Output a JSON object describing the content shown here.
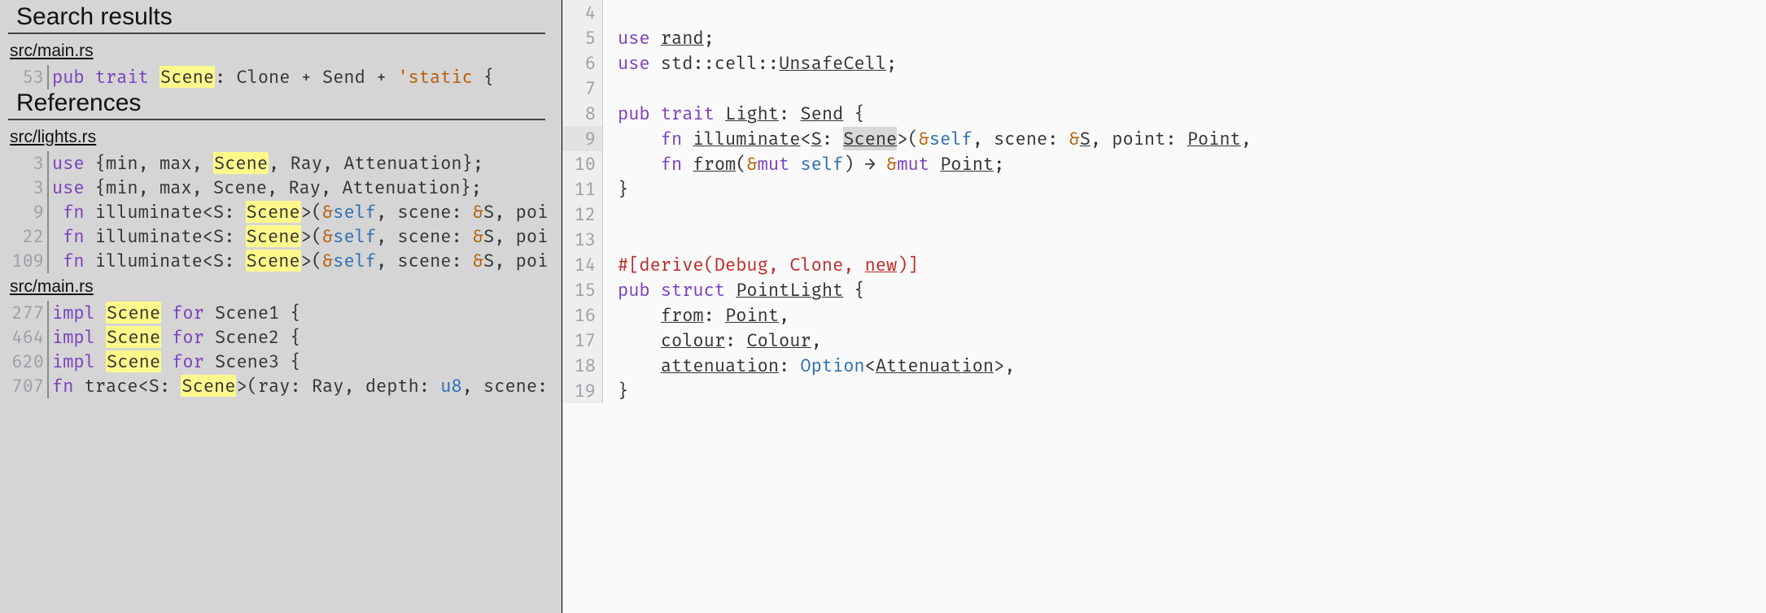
{
  "left": {
    "searchHeader": "Search results",
    "refsHeader": "References",
    "groups": [
      {
        "file": "src/main.rs",
        "results": [
          {
            "line": 53,
            "tokens": [
              [
                "kw",
                "pub"
              ],
              [
                "",
                ""
              ],
              [
                "kw",
                " trait "
              ],
              [
                "hl",
                "Scene"
              ],
              [
                "",
                ""
              ],
              [
                "",
                ": Clone + Send + "
              ],
              [
                "str",
                "'static"
              ],
              [
                "",
                " {"
              ]
            ]
          }
        ]
      }
    ],
    "refGroups": [
      {
        "file": "src/lights.rs",
        "results": [
          {
            "line": 3,
            "tokens": [
              [
                "kw",
                "use"
              ],
              [
                "",
                " {min, max, "
              ],
              [
                "hl",
                "Scene"
              ],
              [
                "",
                ", Ray, Attenuation};"
              ]
            ]
          },
          {
            "line": 3,
            "tokens": [
              [
                "kw",
                "use"
              ],
              [
                "",
                " {min, max, Scene, Ray, Attenuation};"
              ]
            ]
          },
          {
            "line": 9,
            "tokens": [
              [
                "",
                " "
              ],
              [
                "kw",
                "fn"
              ],
              [
                "",
                " illuminate<S: "
              ],
              [
                "hl",
                "Scene"
              ],
              [
                "",
                ">("
              ],
              [
                "amp",
                "&"
              ],
              [
                "self",
                "self"
              ],
              [
                "",
                ", scene: "
              ],
              [
                "amp",
                "&"
              ],
              [
                "",
                "S, poi"
              ]
            ]
          },
          {
            "line": 22,
            "tokens": [
              [
                "",
                " "
              ],
              [
                "kw",
                "fn"
              ],
              [
                "",
                " illuminate<S: "
              ],
              [
                "hl",
                "Scene"
              ],
              [
                "",
                ">("
              ],
              [
                "amp",
                "&"
              ],
              [
                "self",
                "self"
              ],
              [
                "",
                ", scene: "
              ],
              [
                "amp",
                "&"
              ],
              [
                "",
                "S, poi"
              ]
            ]
          },
          {
            "line": 109,
            "tokens": [
              [
                "",
                " "
              ],
              [
                "kw",
                "fn"
              ],
              [
                "",
                " illuminate<S: "
              ],
              [
                "hl",
                "Scene"
              ],
              [
                "",
                ">("
              ],
              [
                "amp",
                "&"
              ],
              [
                "self",
                "self"
              ],
              [
                "",
                ", scene: "
              ],
              [
                "amp",
                "&"
              ],
              [
                "",
                "S, poi"
              ]
            ]
          }
        ]
      },
      {
        "file": "src/main.rs",
        "results": [
          {
            "line": 277,
            "tokens": [
              [
                "kw",
                "impl"
              ],
              [
                "",
                " "
              ],
              [
                "hl",
                "Scene"
              ],
              [
                "",
                " "
              ],
              [
                "kw",
                "for"
              ],
              [
                "",
                " Scene1 {"
              ]
            ]
          },
          {
            "line": 464,
            "tokens": [
              [
                "kw",
                "impl"
              ],
              [
                "",
                " "
              ],
              [
                "hl",
                "Scene"
              ],
              [
                "",
                " "
              ],
              [
                "kw",
                "for"
              ],
              [
                "",
                " Scene2 {"
              ]
            ]
          },
          {
            "line": 620,
            "tokens": [
              [
                "kw",
                "impl"
              ],
              [
                "",
                " "
              ],
              [
                "hl",
                "Scene"
              ],
              [
                "",
                " "
              ],
              [
                "kw",
                "for"
              ],
              [
                "",
                " Scene3 {"
              ]
            ]
          },
          {
            "line": 707,
            "tokens": [
              [
                "kw",
                "fn"
              ],
              [
                "",
                " trace<S: "
              ],
              [
                "hl",
                "Scene"
              ],
              [
                "",
                ">(ray: Ray, depth: "
              ],
              [
                "typ",
                "u8"
              ],
              [
                "",
                ", scene:"
              ]
            ]
          }
        ]
      }
    ]
  },
  "right": {
    "currentLine": 9,
    "lines": [
      {
        "n": 4,
        "toks": []
      },
      {
        "n": 5,
        "toks": [
          [
            "kw",
            "use"
          ],
          [
            "",
            " "
          ],
          [
            "und",
            "rand"
          ],
          [
            "",
            ";"
          ]
        ]
      },
      {
        "n": 6,
        "toks": [
          [
            "kw",
            "use"
          ],
          [
            "",
            " std::cell::"
          ],
          [
            "und",
            "UnsafeCell"
          ],
          [
            "",
            ";"
          ]
        ]
      },
      {
        "n": 7,
        "toks": []
      },
      {
        "n": 8,
        "toks": [
          [
            "kw",
            "pub"
          ],
          [
            "",
            " "
          ],
          [
            "kw",
            "trait"
          ],
          [
            "",
            " "
          ],
          [
            "und",
            "Light"
          ],
          [
            "",
            ": "
          ],
          [
            "und",
            "Send"
          ],
          [
            "",
            " {"
          ]
        ]
      },
      {
        "n": 9,
        "toks": [
          [
            "",
            "    "
          ],
          [
            "kw",
            "fn"
          ],
          [
            "",
            " "
          ],
          [
            "und",
            "illuminate"
          ],
          [
            "",
            "<"
          ],
          [
            "und",
            "S"
          ],
          [
            "",
            ": "
          ],
          [
            "selund",
            "Scene"
          ],
          [
            "",
            ">("
          ],
          [
            "amp",
            "&"
          ],
          [
            "self",
            "self"
          ],
          [
            "",
            ", scene: "
          ],
          [
            "amp",
            "&"
          ],
          [
            "und",
            "S"
          ],
          [
            "",
            ", point: "
          ],
          [
            "und",
            "Point"
          ],
          [
            "",
            ","
          ]
        ]
      },
      {
        "n": 10,
        "toks": [
          [
            "",
            "    "
          ],
          [
            "kw",
            "fn"
          ],
          [
            "",
            " "
          ],
          [
            "und",
            "from"
          ],
          [
            "",
            "("
          ],
          [
            "amp",
            "&"
          ],
          [
            "kw",
            "mut"
          ],
          [
            "",
            " "
          ],
          [
            "self",
            "self"
          ],
          [
            "",
            ") → "
          ],
          [
            "amp",
            "&"
          ],
          [
            "kw",
            "mut"
          ],
          [
            "",
            " "
          ],
          [
            "und",
            "Point"
          ],
          [
            "",
            ";"
          ]
        ]
      },
      {
        "n": 11,
        "toks": [
          [
            "",
            "}"
          ]
        ]
      },
      {
        "n": 12,
        "toks": []
      },
      {
        "n": 13,
        "toks": []
      },
      {
        "n": 14,
        "toks": [
          [
            "attr",
            "#[derive(Debug, Clone, "
          ],
          [
            "attrund",
            "new"
          ],
          [
            "attr",
            ")]"
          ]
        ]
      },
      {
        "n": 15,
        "toks": [
          [
            "kw",
            "pub"
          ],
          [
            "",
            " "
          ],
          [
            "kw",
            "struct"
          ],
          [
            "",
            " "
          ],
          [
            "und",
            "PointLight"
          ],
          [
            "",
            " {"
          ]
        ]
      },
      {
        "n": 16,
        "toks": [
          [
            "",
            "    "
          ],
          [
            "und",
            "from"
          ],
          [
            "",
            ": "
          ],
          [
            "und",
            "Point"
          ],
          [
            "",
            ","
          ]
        ]
      },
      {
        "n": 17,
        "toks": [
          [
            "",
            "    "
          ],
          [
            "und",
            "colour"
          ],
          [
            "",
            ": "
          ],
          [
            "und",
            "Colour"
          ],
          [
            "",
            ","
          ]
        ]
      },
      {
        "n": 18,
        "toks": [
          [
            "",
            "    "
          ],
          [
            "und",
            "attenuation"
          ],
          [
            "",
            ": "
          ],
          [
            "typ",
            "Option"
          ],
          [
            "",
            "<"
          ],
          [
            "und",
            "Attenuation"
          ],
          [
            "",
            ">,"
          ]
        ]
      },
      {
        "n": 19,
        "toks": [
          [
            "",
            "}"
          ]
        ]
      }
    ]
  }
}
